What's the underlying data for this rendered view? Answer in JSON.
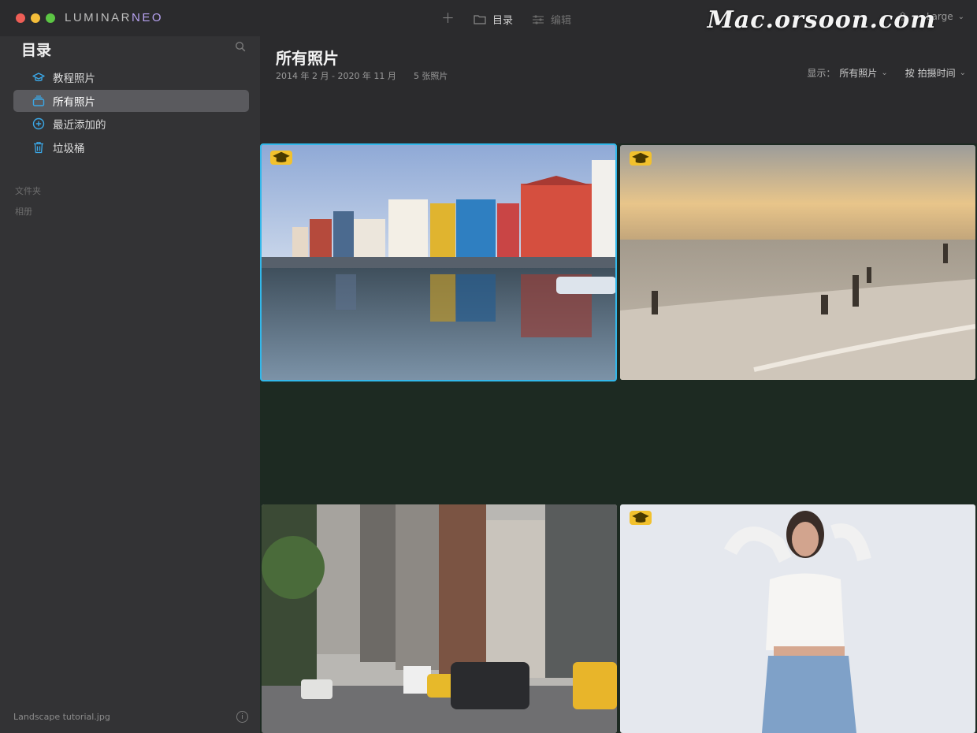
{
  "window": {
    "brand_main": "LUMINAR",
    "brand_accent": "NEO",
    "watermark": "Mac.orsoon.com"
  },
  "toolbar": {
    "add_icon": "plus-icon",
    "catalog_label": "目录",
    "edit_label": "编辑",
    "size_label": "Large",
    "share_icon": "share-icon"
  },
  "sidebar": {
    "title": "目录",
    "items": [
      {
        "label": "教程照片",
        "icon": "graduation-cap-icon",
        "active": false
      },
      {
        "label": "所有照片",
        "icon": "photos-stack-icon",
        "active": true
      },
      {
        "label": "最近添加的",
        "icon": "plus-circle-icon",
        "active": false
      },
      {
        "label": "垃圾桶",
        "icon": "trash-icon",
        "active": false
      }
    ],
    "section_folders": "文件夹",
    "section_albums": "相册",
    "footer_filename": "Landscape tutorial.jpg"
  },
  "main": {
    "title": "所有照片",
    "date_range": "2014 年 2 月 - 2020 年 11 月",
    "count": "5 张照片",
    "show_label": "显示：",
    "show_value": "所有照片",
    "sort_label": "按 拍摄时间"
  },
  "photos": [
    {
      "name": "colorful-houses-canal",
      "tutorial": true,
      "selected": true
    },
    {
      "name": "beach-sunset",
      "tutorial": true,
      "selected": false
    },
    {
      "name": "city-street-taxis",
      "tutorial": false,
      "selected": false
    },
    {
      "name": "woman-portrait-white",
      "tutorial": true,
      "selected": false
    }
  ],
  "colors": {
    "accent": "#32b8ea",
    "badge": "#f2c12d",
    "sidebar_bg": "#333335",
    "main_bg": "#2b2b2d"
  }
}
